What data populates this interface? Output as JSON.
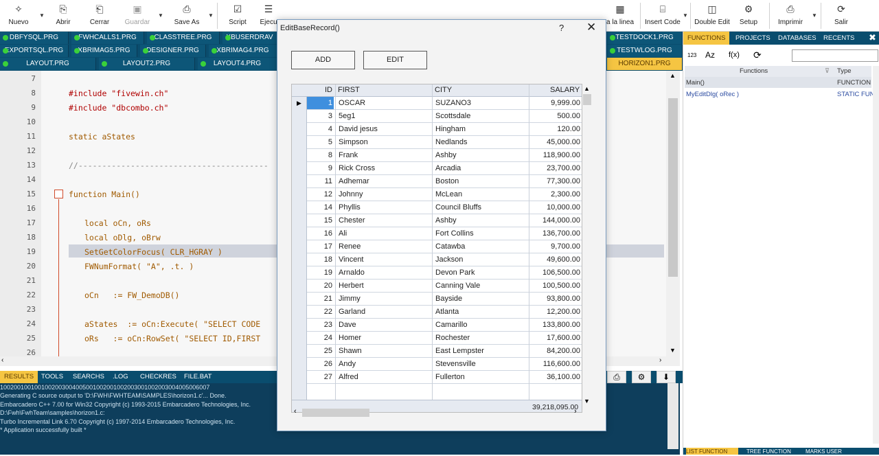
{
  "toolbar": {
    "buttons": [
      {
        "label": "Nuevo",
        "icon": "new-file-icon",
        "glyph": "✧"
      },
      {
        "label": "Abrir",
        "icon": "open-file-icon",
        "glyph": "⎘"
      },
      {
        "label": "Cerrar",
        "icon": "close-file-icon",
        "glyph": "⎗"
      },
      {
        "label": "Guardar",
        "icon": "save-icon",
        "glyph": "💾"
      },
      {
        "label": "Save As",
        "icon": "save-as-icon",
        "glyph": "⎙"
      },
      {
        "label": "Script",
        "icon": "script-icon",
        "glyph": "☑"
      },
      {
        "label": "Ejecu",
        "icon": "execute-icon",
        "glyph": "☰"
      },
      {
        "label": "a la linea",
        "icon": "goto-line-icon",
        "glyph": "▦"
      },
      {
        "label": "Insert Code",
        "icon": "insert-code-icon",
        "glyph": "⌸"
      },
      {
        "label": "Double Edit",
        "icon": "double-edit-icon",
        "glyph": "◫"
      },
      {
        "label": "Setup",
        "icon": "setup-icon",
        "glyph": "⚙"
      },
      {
        "label": "Imprimir",
        "icon": "print-icon",
        "glyph": "⎙"
      },
      {
        "label": "Salir",
        "icon": "exit-icon",
        "glyph": "⟳"
      }
    ]
  },
  "file_tabs": {
    "row1": [
      "DBFYSQL.PRG",
      "FWHCALLS1.PRG",
      "CLASSTREE.PRG",
      "XBUSERDRAV",
      "TESTDOCK1.PRG"
    ],
    "row2": [
      "EXPORTSQL.PRG",
      "XBRIMAG5.PRG",
      "DESIGNER.PRG",
      "XBRIMAG4.PRG",
      "TESTWLOG.PRG"
    ],
    "row3": [
      "LAYOUT.PRG",
      "LAYOUT2.PRG",
      "LAYOUT4.PRG",
      "HORIZON1.PRG"
    ]
  },
  "editor": {
    "line_numbers": [
      "7",
      "8",
      "9",
      "10",
      "11",
      "12",
      "13",
      "14",
      "15",
      "16",
      "17",
      "18",
      "19",
      "20",
      "21",
      "22",
      "23",
      "24",
      "25",
      "26"
    ],
    "lines": {
      "l8": "#include \"fivewin.ch\"",
      "l9": "#include \"dbcombo.ch\"",
      "l11": "static aStates",
      "l13": "//----------------------------------------",
      "l15": "function Main()",
      "l17": "local oCn, oRs",
      "l18": "local oDlg, oBrw",
      "l19": "SetGetColorFocus( CLR_HGRAY )",
      "l20": "FWNumFormat( \"A\", .t. )",
      "l22": "oCn   := FW_DemoDB()",
      "l24": "aStates  := oCn:Execute( \"SELECT CODE",
      "l25": "oRs   := oCn:RowSet( \"SELECT ID,FIRST"
    }
  },
  "bottom_tabs": [
    "RESULTS",
    "TOOLS",
    "SEARCHS",
    ".LOG",
    "CHECKRES",
    "FILE.BAT"
  ],
  "results_lines": [
    "1002001001001002003004005001002001002003001002003004005006007",
    "Generating C source output to 'D:\\FWH\\FWHTEAM\\SAMPLES\\horizon1.c'... Done.",
    "Embarcadero C++ 7.00 for Win32 Copyright (c) 1993-2015 Embarcadero Technologies, Inc.",
    "D:\\Fwh\\FwhTeam\\samples\\horizon1.c:",
    "Turbo Incremental Link 6.70 Copyright (c) 1997-2014 Embarcadero Technologies, Inc.",
    "* Application successfully built *"
  ],
  "right_panel": {
    "tabs": [
      "FUNCTIONS",
      "PROJECTS",
      "DATABASES",
      "RECENTS"
    ],
    "columns": [
      "Functions",
      "Type"
    ],
    "rows": [
      {
        "name": "Main()",
        "type": "FUNCTION"
      },
      {
        "name": "MyEditDlg( oRec )",
        "type": "STATIC FUNC"
      }
    ],
    "bottom_tabs": [
      "LIST FUNCTION",
      "TREE FUNCTION",
      "MARKS USER"
    ],
    "tool_labels": [
      "123",
      "Az",
      "f(x)",
      "⟳"
    ]
  },
  "dialog": {
    "title": "EditBaseRecord()",
    "help": "?",
    "close": "✕",
    "add_label": "ADD",
    "edit_label": "EDIT",
    "columns": [
      "ID",
      "FIRST",
      "CITY",
      "SALARY"
    ],
    "rows": [
      {
        "id": "1",
        "first": "OSCAR",
        "city": "SUZANO3",
        "salary": "9,999.00"
      },
      {
        "id": "3",
        "first": "5eg1",
        "city": "Scottsdale",
        "salary": "500.00"
      },
      {
        "id": "4",
        "first": "David  jesus",
        "city": "Hingham",
        "salary": "120.00"
      },
      {
        "id": "5",
        "first": "Simpson",
        "city": "Nedlands",
        "salary": "45,000.00"
      },
      {
        "id": "8",
        "first": "Frank",
        "city": "Ashby",
        "salary": "118,900.00"
      },
      {
        "id": "9",
        "first": "Rick Cross",
        "city": "Arcadia",
        "salary": "23,700.00"
      },
      {
        "id": "11",
        "first": "Adhemar",
        "city": "Boston",
        "salary": "77,300.00"
      },
      {
        "id": "12",
        "first": "Johnny",
        "city": "McLean",
        "salary": "2,300.00"
      },
      {
        "id": "14",
        "first": "Phyllis",
        "city": "Council Bluffs",
        "salary": "10,000.00"
      },
      {
        "id": "15",
        "first": "Chester",
        "city": "Ashby",
        "salary": "144,000.00"
      },
      {
        "id": "16",
        "first": "Ali",
        "city": "Fort Collins",
        "salary": "136,700.00"
      },
      {
        "id": "17",
        "first": "Renee",
        "city": "Catawba",
        "salary": "9,700.00"
      },
      {
        "id": "18",
        "first": "Vincent",
        "city": "Jackson",
        "salary": "49,600.00"
      },
      {
        "id": "19",
        "first": "Arnaldo",
        "city": "Devon Park",
        "salary": "106,500.00"
      },
      {
        "id": "20",
        "first": "Herbert",
        "city": "Canning Vale",
        "salary": "100,500.00"
      },
      {
        "id": "21",
        "first": "Jimmy",
        "city": "Bayside",
        "salary": "93,800.00"
      },
      {
        "id": "22",
        "first": "Garland",
        "city": "Atlanta",
        "salary": "12,200.00"
      },
      {
        "id": "23",
        "first": "Dave",
        "city": "Camarillo",
        "salary": "133,800.00"
      },
      {
        "id": "24",
        "first": "Homer",
        "city": "Rochester",
        "salary": "17,600.00"
      },
      {
        "id": "25",
        "first": "Shawn",
        "city": "East Lempster",
        "salary": "84,200.00"
      },
      {
        "id": "26",
        "first": "Andy",
        "city": "Stevensville",
        "salary": "116,600.00"
      },
      {
        "id": "27",
        "first": "Alfred",
        "city": "Fullerton",
        "salary": "36,100.00"
      }
    ],
    "salary_total": "39,218,095.00"
  }
}
